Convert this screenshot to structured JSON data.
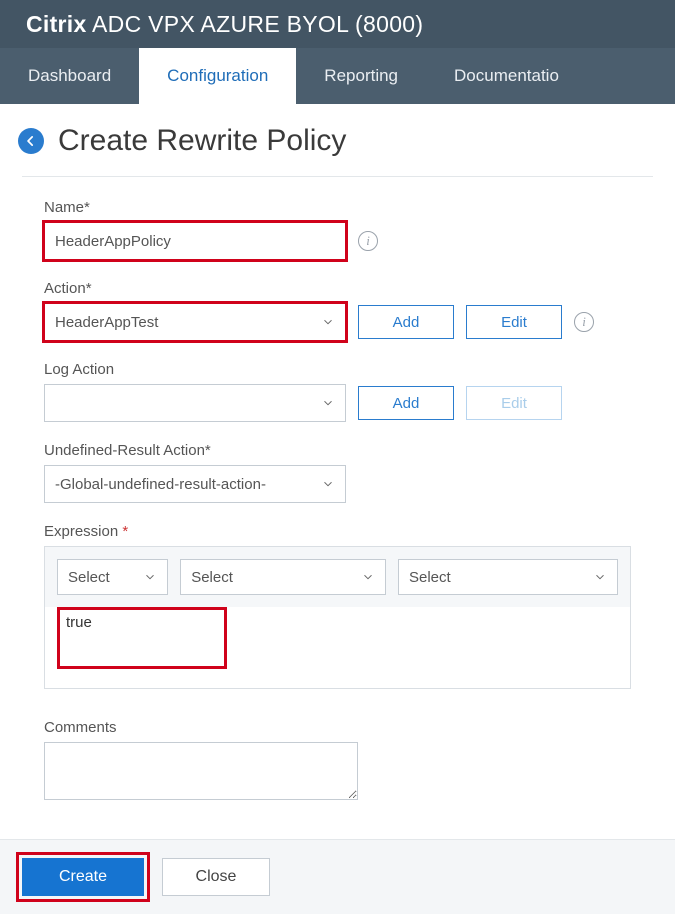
{
  "header": {
    "brand_bold": "Citrix",
    "brand_rest": " ADC VPX AZURE BYOL (8000)"
  },
  "tabs": [
    {
      "label": "Dashboard",
      "active": false
    },
    {
      "label": "Configuration",
      "active": true
    },
    {
      "label": "Reporting",
      "active": false
    },
    {
      "label": "Documentatio",
      "active": false
    }
  ],
  "page": {
    "title": "Create Rewrite Policy"
  },
  "form": {
    "name": {
      "label": "Name*",
      "value": "HeaderAppPolicy"
    },
    "action": {
      "label": "Action*",
      "value": "HeaderAppTest",
      "add": "Add",
      "edit": "Edit"
    },
    "log_action": {
      "label": "Log Action",
      "value": "",
      "add": "Add",
      "edit": "Edit"
    },
    "undef": {
      "label": "Undefined-Result Action*",
      "value": "-Global-undefined-result-action-"
    },
    "expression": {
      "label": "Expression ",
      "req": "*",
      "select": "Select",
      "value": "true"
    },
    "comments": {
      "label": "Comments",
      "value": ""
    }
  },
  "footer": {
    "create": "Create",
    "close": "Close"
  }
}
